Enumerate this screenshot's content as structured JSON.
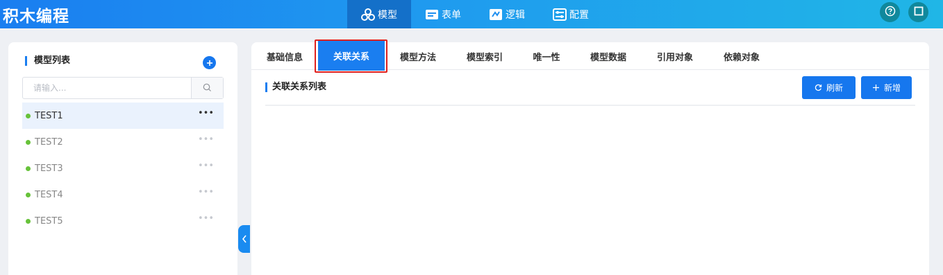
{
  "app": {
    "title": "积木编程"
  },
  "nav": [
    {
      "label": "模型",
      "icon": "cubes-icon",
      "active": true
    },
    {
      "label": "表单",
      "icon": "form-icon",
      "active": false
    },
    {
      "label": "逻辑",
      "icon": "logic-icon",
      "active": false
    },
    {
      "label": "配置",
      "icon": "config-icon",
      "active": false
    }
  ],
  "header_buttons": [
    {
      "icon": "help-icon"
    },
    {
      "icon": "fullscreen-icon"
    }
  ],
  "sidebar": {
    "title": "模型列表",
    "search_placeholder": "请输入...",
    "items": [
      {
        "label": "TEST1",
        "status_color": "#67c23a",
        "more": "•••"
      },
      {
        "label": "TEST2",
        "status_color": "#67c23a",
        "more": "•••"
      },
      {
        "label": "TEST3",
        "status_color": "#67c23a",
        "more": "•••"
      },
      {
        "label": "TEST4",
        "status_color": "#67c23a",
        "more": "•••"
      },
      {
        "label": "TEST5",
        "status_color": "#67c23a",
        "more": "•••"
      }
    ],
    "selected_index": 0
  },
  "tabs": [
    {
      "label": "基础信息"
    },
    {
      "label": "关联关系"
    },
    {
      "label": "模型方法"
    },
    {
      "label": "模型索引"
    },
    {
      "label": "唯一性"
    },
    {
      "label": "模型数据"
    },
    {
      "label": "引用对象"
    },
    {
      "label": "依赖对象"
    }
  ],
  "active_tab_index": 1,
  "main": {
    "section_title": "关联关系列表",
    "refresh_label": "刷新",
    "add_label": "新增"
  },
  "colors": {
    "accent": "#1677ee",
    "highlight_border": "#e0201d",
    "status_green": "#67c23a"
  }
}
